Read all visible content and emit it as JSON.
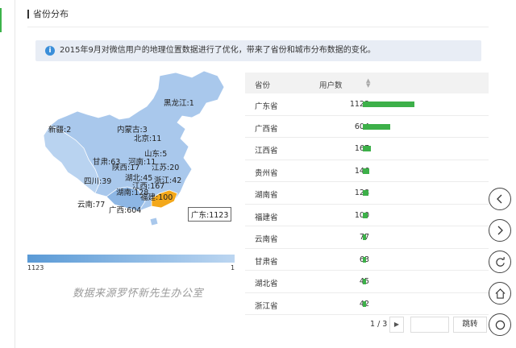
{
  "section": {
    "title": "省份分布"
  },
  "notice": {
    "text": "2015年9月对微信用户的地理位置数据进行了优化，带来了省份和城市分布数据的变化。",
    "icon": "info-icon"
  },
  "map": {
    "labels": {
      "heilongjiang": "黑龙江:1",
      "xinjiang": "新疆:2",
      "neimenggu": "内蒙古:3",
      "beijing": "北京:11",
      "henan": "河南:11",
      "shandong": "山东:5",
      "gansu": "甘肃:63",
      "shaanxi": "陕西:17",
      "jiangsu": "江苏:20",
      "hubei": "湖北:45",
      "zhejiang": "浙江:42",
      "sichuan": "四川:39",
      "jiangxi": "江西:167",
      "hunan": "湖南:128",
      "fujian": "福建:100",
      "yunnan": "云南:77",
      "guangxi": "广西:604",
      "guangdong": "广东:1123"
    },
    "colors": {
      "low": "#bcd6f1",
      "high": "#5a9ad6",
      "highlight": "#f3a81b"
    }
  },
  "legend": {
    "min": "1123",
    "max": "1"
  },
  "watermark": "数据来源罗怀新先生办公室",
  "table": {
    "headers": {
      "province": "省份",
      "users": "用户数"
    },
    "max_value": 1123,
    "bar_color": "#3db049",
    "rows": [
      {
        "province": "广东省",
        "value": "1123"
      },
      {
        "province": "广西省",
        "value": "604"
      },
      {
        "province": "江西省",
        "value": "167"
      },
      {
        "province": "贵州省",
        "value": "146"
      },
      {
        "province": "湖南省",
        "value": "128"
      },
      {
        "province": "福建省",
        "value": "100"
      },
      {
        "province": "云南省",
        "value": "77"
      },
      {
        "province": "甘肃省",
        "value": "63"
      },
      {
        "province": "湖北省",
        "value": "45"
      },
      {
        "province": "浙江省",
        "value": "42"
      }
    ]
  },
  "pager": {
    "text": "1 / 3",
    "jump_label": "跳转"
  },
  "float_buttons": [
    "chevron-left-icon",
    "chevron-right-icon",
    "refresh-icon",
    "home-icon",
    "circle-icon"
  ]
}
